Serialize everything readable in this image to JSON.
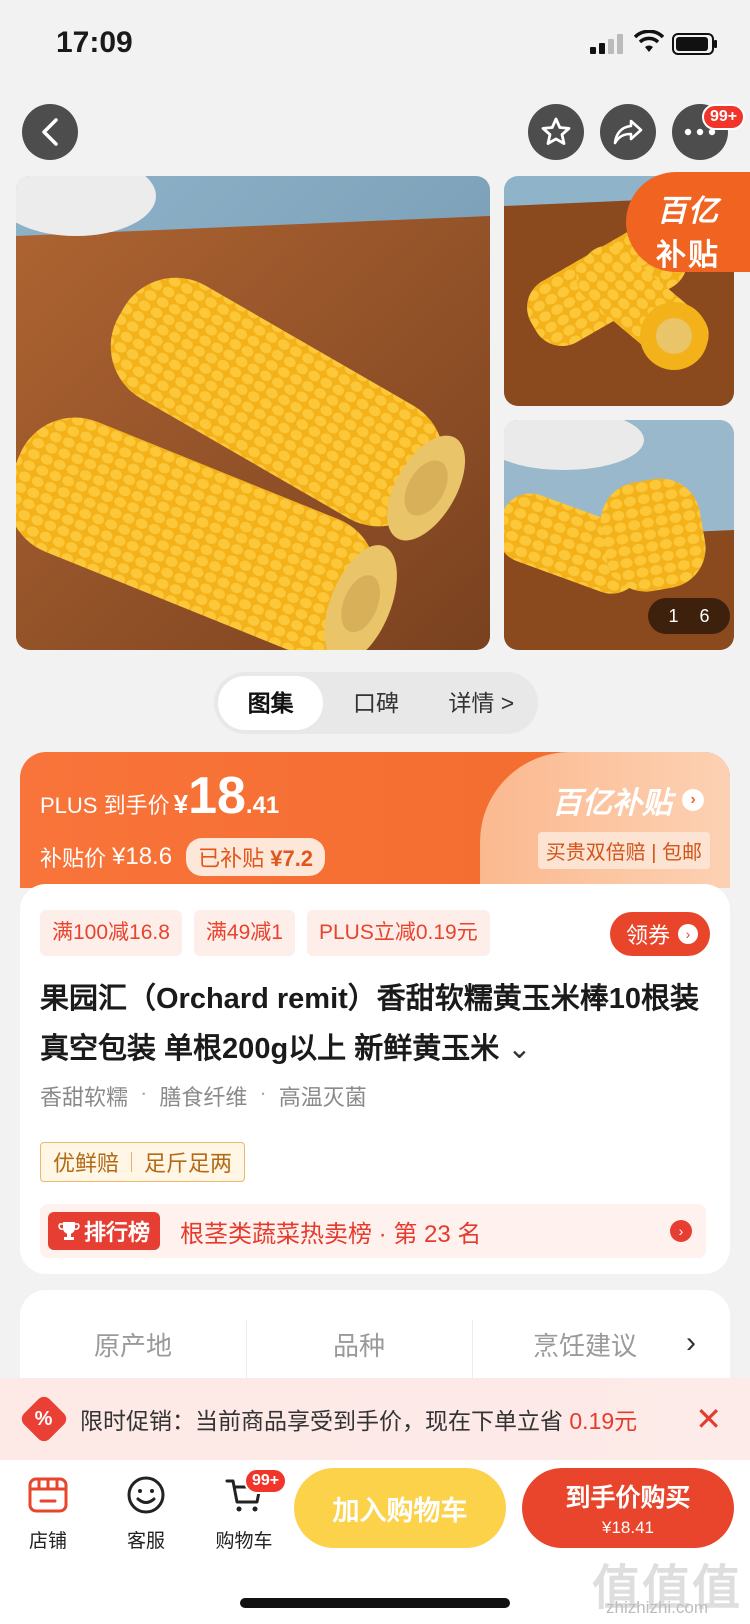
{
  "status_bar": {
    "time": "17:09"
  },
  "nav": {
    "more_badge": "99+"
  },
  "gallery": {
    "subsidy_line1": "百亿",
    "subsidy_line2": "补贴",
    "page_current": "1",
    "page_total": "6"
  },
  "tabs": [
    {
      "label": "图集"
    },
    {
      "label": "口碑"
    },
    {
      "label": "详情 >"
    }
  ],
  "price": {
    "plus_label": "PLUS 到手价",
    "currency": "¥",
    "price_int": "18",
    "price_dec": ".41",
    "sub_label": "补贴价",
    "sub_price": "¥18.6",
    "already_label": "已补贴",
    "already_amount": "¥7.2",
    "brand": "百亿补贴",
    "double_text": "买贵双倍赔 | 包邮"
  },
  "promos": [
    "满100减16.8",
    "满49减1",
    "PLUS立减0.19元"
  ],
  "coupon_label": "领券",
  "product": {
    "title": "果园汇（Orchard remit）香甜软糯黄玉米棒10根装真空包装 单根200g以上 新鲜黄玉米",
    "features": [
      "香甜软糯",
      "膳食纤维",
      "高温灭菌"
    ],
    "guarantees": [
      "优鲜赔",
      "足斤足两"
    ],
    "rank_tag": "排行榜",
    "rank_text": "根茎类蔬菜热卖榜 · 第 23 名"
  },
  "attributes": [
    {
      "label": "原产地"
    },
    {
      "label": "品种"
    },
    {
      "label": "烹饪建议"
    }
  ],
  "banner": {
    "prefix": "限时促销：当前商品享受到手价，现在下单立省",
    "amount": "0.19元"
  },
  "bottom_bar": {
    "store": "店铺",
    "service": "客服",
    "cart": "购物车",
    "cart_badge": "99+",
    "add_cart": "加入购物车",
    "buy_line1": "到手价购买",
    "buy_line2": "¥18.41"
  },
  "watermark": {
    "main": "值值值",
    "sub": "zhizhizhi.com"
  },
  "colors": {
    "accent_orange": "#f26b2d",
    "accent_red": "#e8452c",
    "cart_yellow": "#fcd24a"
  }
}
